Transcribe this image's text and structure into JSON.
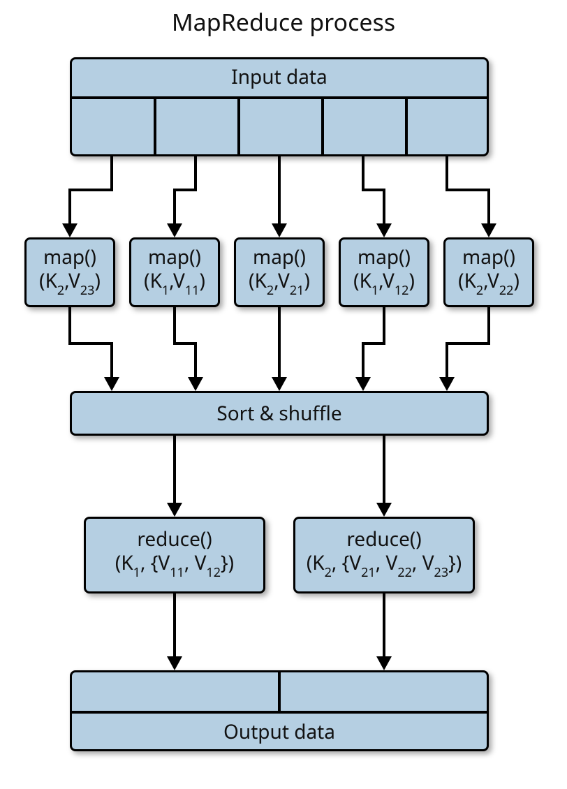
{
  "title": "MapReduce process",
  "input": {
    "label": "Input data",
    "splits": 5
  },
  "maps": [
    {
      "fn": "map()",
      "key": "K",
      "ksub": "2",
      "val": "V",
      "vsub": "23"
    },
    {
      "fn": "map()",
      "key": "K",
      "ksub": "1",
      "val": "V",
      "vsub": "11"
    },
    {
      "fn": "map()",
      "key": "K",
      "ksub": "2",
      "val": "V",
      "vsub": "21"
    },
    {
      "fn": "map()",
      "key": "K",
      "ksub": "1",
      "val": "V",
      "vsub": "12"
    },
    {
      "fn": "map()",
      "key": "K",
      "ksub": "2",
      "val": "V",
      "vsub": "22"
    }
  ],
  "shuffle": {
    "label": "Sort & shuffle"
  },
  "reduces": [
    {
      "fn": "reduce()",
      "key": "K",
      "ksub": "1",
      "vals": [
        {
          "v": "V",
          "s": "11"
        },
        {
          "v": "V",
          "s": "12"
        }
      ]
    },
    {
      "fn": "reduce()",
      "key": "K",
      "ksub": "2",
      "vals": [
        {
          "v": "V",
          "s": "21"
        },
        {
          "v": "V",
          "s": "22"
        },
        {
          "v": "V",
          "s": "23"
        }
      ]
    }
  ],
  "output": {
    "label": "Output data",
    "parts": 2
  },
  "colors": {
    "fill": "#b5cfe2",
    "stroke": "#000000"
  }
}
